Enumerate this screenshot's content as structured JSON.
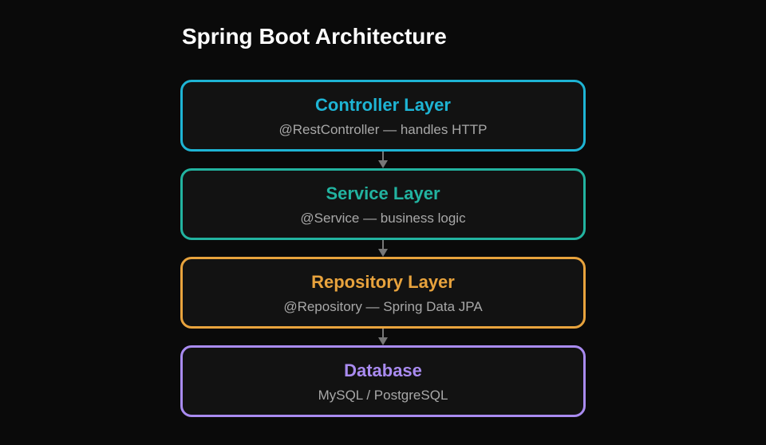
{
  "title": "Spring Boot Architecture",
  "layers": [
    {
      "name": "Controller Layer",
      "description": "@RestController — handles HTTP",
      "color": "#1eb4d4"
    },
    {
      "name": "Service Layer",
      "description": "@Service — business logic",
      "color": "#22b3a0"
    },
    {
      "name": "Repository Layer",
      "description": "@Repository — Spring Data JPA",
      "color": "#e8a33d"
    },
    {
      "name": "Database",
      "description": "MySQL / PostgreSQL",
      "color": "#a98bf0"
    }
  ],
  "arrow_color": "#777777"
}
